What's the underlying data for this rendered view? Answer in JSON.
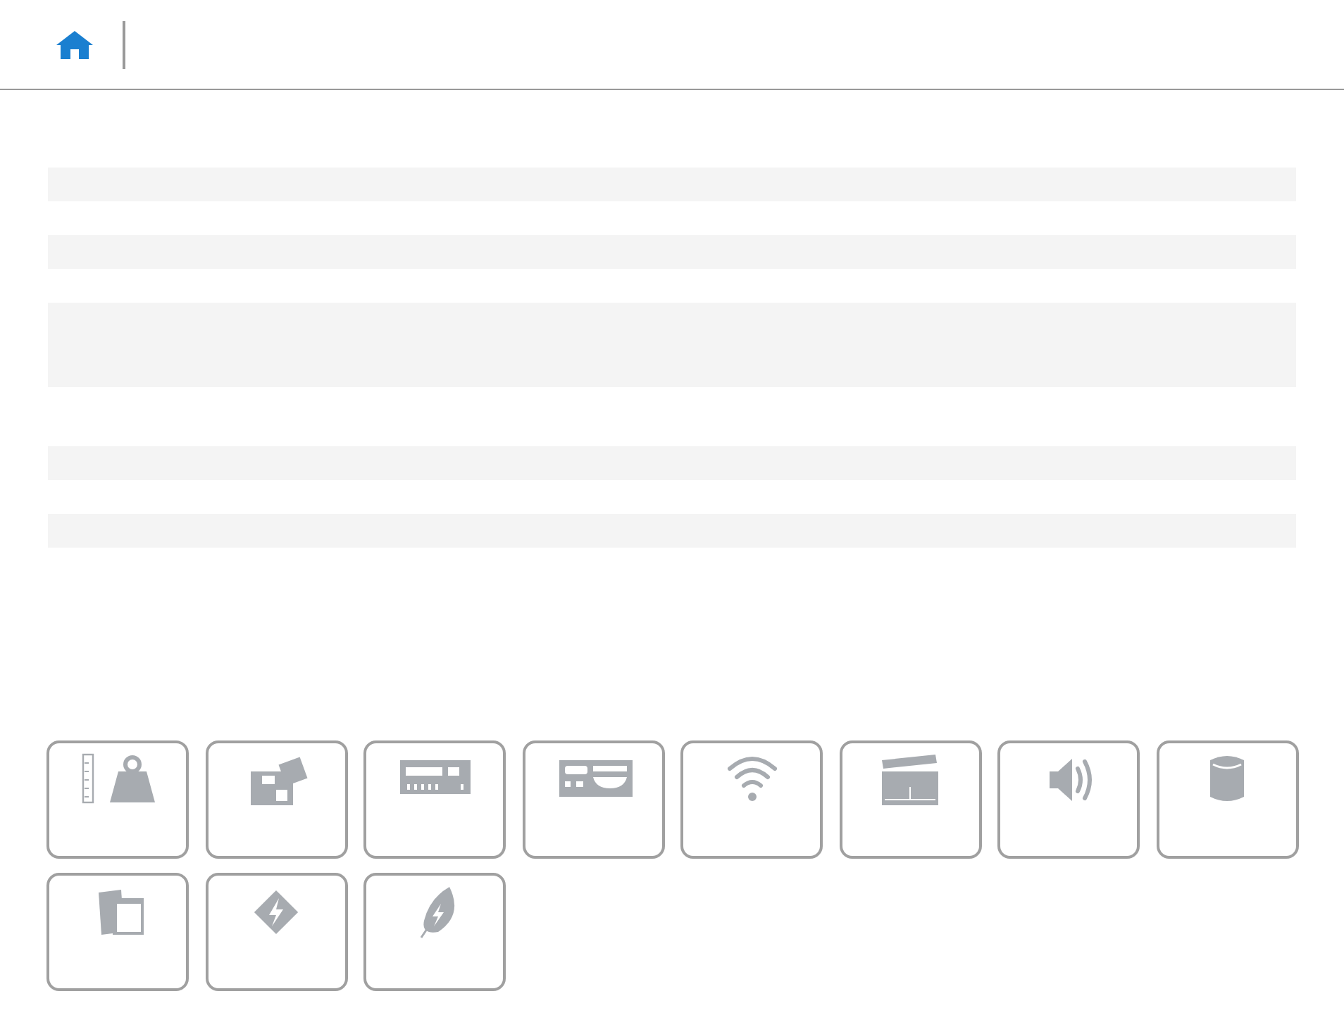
{
  "header": {
    "home_button": true
  },
  "spec_rows": [
    {
      "kind": "single"
    },
    {
      "kind": "single"
    },
    {
      "kind": "single"
    },
    {
      "kind": "single"
    },
    {
      "kind": "double"
    },
    {
      "kind": "gap"
    },
    {
      "kind": "single"
    },
    {
      "kind": "single"
    },
    {
      "kind": "single"
    }
  ],
  "tiles": [
    {
      "kind": "weight"
    },
    {
      "kind": "board"
    },
    {
      "kind": "ports"
    },
    {
      "kind": "panel"
    },
    {
      "kind": "wifi"
    },
    {
      "kind": "video"
    },
    {
      "kind": "audio"
    },
    {
      "kind": "storage"
    },
    {
      "kind": "cards"
    },
    {
      "kind": "power"
    },
    {
      "kind": "energy"
    }
  ]
}
